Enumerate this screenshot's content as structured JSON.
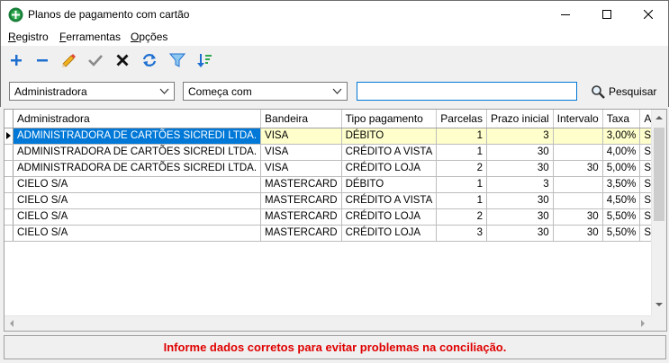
{
  "window": {
    "title": "Planos de pagamento com cartão"
  },
  "menu": {
    "items": [
      {
        "accel": "R",
        "rest": "egistro"
      },
      {
        "accel": "F",
        "rest": "erramentas"
      },
      {
        "accel": "O",
        "rest": "pções"
      }
    ]
  },
  "toolbar": {
    "icons": [
      "add-icon",
      "remove-icon",
      "edit-pencil-icon",
      "confirm-check-icon",
      "cancel-x-icon",
      "refresh-icon",
      "filter-funnel-icon",
      "sort-icon"
    ]
  },
  "filter": {
    "field_value": "Administradora",
    "condition_value": "Começa com",
    "search_value": "",
    "search_label": "Pesquisar"
  },
  "grid": {
    "columns": [
      "Administradora",
      "Bandeira",
      "Tipo pagamento",
      "Parcelas",
      "Prazo inicial",
      "Intervalo",
      "Taxa",
      "Ativo"
    ],
    "rows": [
      [
        "ADMINISTRADORA DE CARTÕES SICREDI LTDA.",
        "VISA",
        "DÉBITO",
        "1",
        "3",
        "",
        "3,00%",
        "SIM"
      ],
      [
        "ADMINISTRADORA DE CARTÕES SICREDI LTDA.",
        "VISA",
        "CRÉDITO A VISTA",
        "1",
        "30",
        "",
        "4,00%",
        "SIM"
      ],
      [
        "ADMINISTRADORA DE CARTÕES SICREDI LTDA.",
        "VISA",
        "CRÉDITO LOJA",
        "2",
        "30",
        "30",
        "5,00%",
        "SIM"
      ],
      [
        "CIELO S/A",
        "MASTERCARD",
        "DÉBITO",
        "1",
        "3",
        "",
        "3,50%",
        "SIM"
      ],
      [
        "CIELO S/A",
        "MASTERCARD",
        "CRÉDITO A VISTA",
        "1",
        "30",
        "",
        "4,50%",
        "SIM"
      ],
      [
        "CIELO S/A",
        "MASTERCARD",
        "CRÉDITO LOJA",
        "2",
        "30",
        "30",
        "5,50%",
        "SIM"
      ],
      [
        "CIELO S/A",
        "MASTERCARD",
        "CRÉDITO LOJA",
        "3",
        "30",
        "30",
        "5,50%",
        "SIM"
      ]
    ]
  },
  "status": {
    "message": "Informe dados corretos para evitar problemas na conciliação."
  },
  "colors": {
    "selection": "#0078d7",
    "current_row": "#ffffcc",
    "status_text": "#e00000"
  }
}
